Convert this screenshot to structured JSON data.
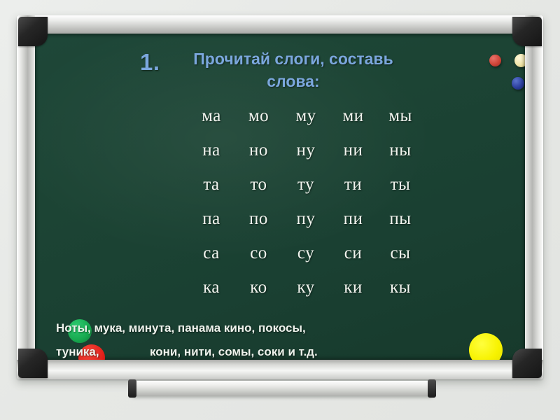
{
  "scene": {
    "type": "classroom-chalkboard-slide",
    "background_color": "#e8eae7",
    "board_color": "#1c4434",
    "frame_color": "#c8c9c6",
    "accent_color": "#7ba7dd",
    "chalk_color": "#eef2ec"
  },
  "title": {
    "number": "1.",
    "line1": "Прочитай слоги, составь",
    "line2": "слова:",
    "color": "#7ba7dd"
  },
  "syllables": {
    "rows": [
      {
        "cells": [
          "ма",
          "мо",
          "му",
          "ми",
          "мы"
        ]
      },
      {
        "cells": [
          "на",
          "но",
          "ну",
          "ни",
          "ны"
        ]
      },
      {
        "cells": [
          "та",
          "то",
          "ту",
          "ти",
          "ты"
        ]
      },
      {
        "cells": [
          "па",
          "по",
          "пу",
          "пи",
          "пы"
        ]
      },
      {
        "cells": [
          "са",
          "со",
          "су",
          "си",
          "сы"
        ]
      },
      {
        "cells": [
          "ка",
          "ко",
          "ку",
          "ки",
          "кы"
        ]
      }
    ]
  },
  "wordlist": {
    "line1": "Ноты, мука, минута, панама кино, покосы,",
    "line2_left": "туника,",
    "line2_right": "кони, нити, сомы, соки и т.д."
  },
  "magnets": [
    {
      "name": "red-magnet",
      "color": "#cf4438"
    },
    {
      "name": "cream-magnet",
      "color": "#f0e5a8"
    },
    {
      "name": "blue-magnet",
      "color": "#2c3f9e"
    }
  ],
  "dots": [
    {
      "name": "green-dot",
      "color": "#17a94f"
    },
    {
      "name": "red-dot",
      "color": "#e2201a"
    },
    {
      "name": "yellow-dot",
      "color": "#f7f200"
    }
  ]
}
